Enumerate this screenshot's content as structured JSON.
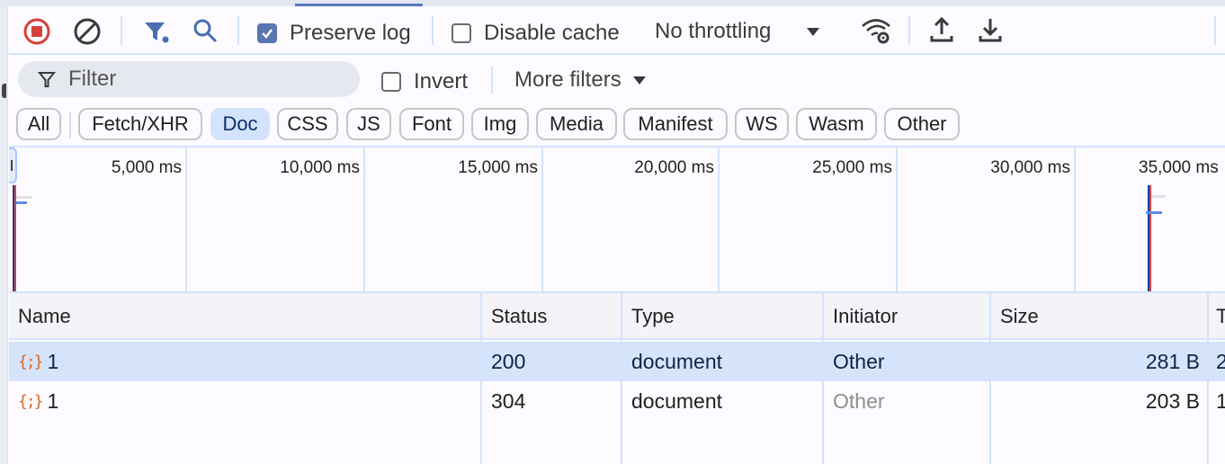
{
  "toolbar": {
    "record_icon": "stop-recording-icon",
    "clear_icon": "clear-icon",
    "filter_toggle_icon": "filter-icon",
    "search_icon": "search-icon",
    "preserve_log": {
      "label": "Preserve log",
      "checked": true
    },
    "disable_cache": {
      "label": "Disable cache",
      "checked": false
    },
    "throttling": {
      "selected": "No throttling"
    },
    "network_conditions_icon": "wifi-settings-icon",
    "import_icon": "upload-icon",
    "export_icon": "download-icon"
  },
  "filterbar": {
    "filter_placeholder": "Filter",
    "filter_value": "",
    "invert": {
      "label": "Invert",
      "checked": false
    },
    "more_filters_label": "More filters"
  },
  "type_chips": [
    {
      "label": "All",
      "selected": false
    },
    {
      "label": "Fetch/XHR",
      "selected": false
    },
    {
      "label": "Doc",
      "selected": true
    },
    {
      "label": "CSS",
      "selected": false
    },
    {
      "label": "JS",
      "selected": false
    },
    {
      "label": "Font",
      "selected": false
    },
    {
      "label": "Img",
      "selected": false
    },
    {
      "label": "Media",
      "selected": false
    },
    {
      "label": "Manifest",
      "selected": false
    },
    {
      "label": "WS",
      "selected": false
    },
    {
      "label": "Wasm",
      "selected": false
    },
    {
      "label": "Other",
      "selected": false
    }
  ],
  "overview": {
    "ticks": [
      "5,000 ms",
      "10,000 ms",
      "15,000 ms",
      "20,000 ms",
      "25,000 ms",
      "30,000 ms",
      "35,000 ms"
    ],
    "colors": {
      "dom_content_loaded": "#1a3d9e",
      "load": "#d6453d",
      "request_bar": "#5b8ce8",
      "waiting_bar": "#dfe1e5"
    }
  },
  "table": {
    "columns": [
      "Name",
      "Status",
      "Type",
      "Initiator",
      "Size",
      "T"
    ],
    "rows": [
      {
        "name": "1",
        "status": "200",
        "type": "document",
        "initiator": "Other",
        "size": "281 B",
        "time": "2",
        "selected": true,
        "initiator_muted": false
      },
      {
        "name": "1",
        "status": "304",
        "type": "document",
        "initiator": "Other",
        "size": "203 B",
        "time": "1",
        "selected": false,
        "initiator_muted": true
      }
    ]
  }
}
